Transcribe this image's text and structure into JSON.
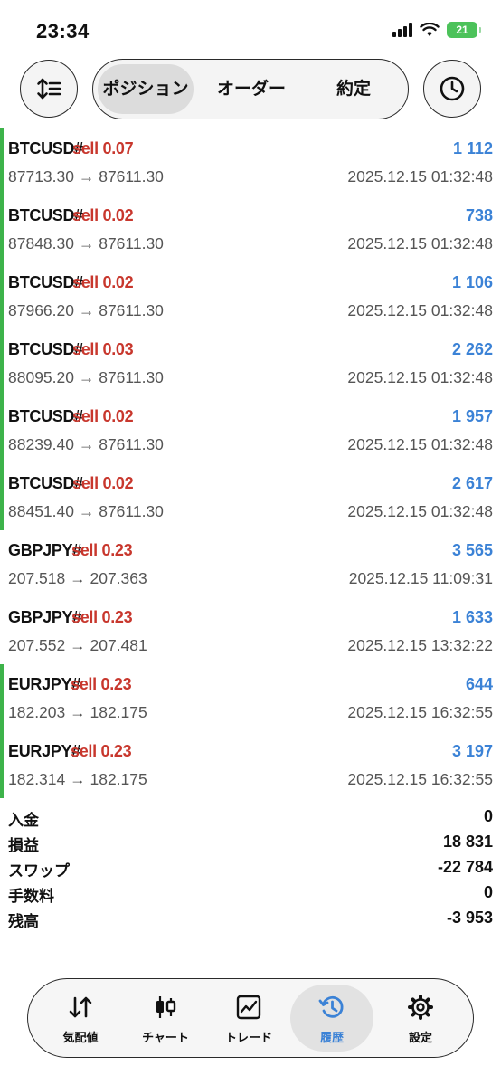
{
  "status_bar": {
    "time": "23:34",
    "battery": "21"
  },
  "top_tabs": {
    "positions": "ポジション",
    "orders": "オーダー",
    "deals": "約定"
  },
  "trades": [
    {
      "symbol": "BTCUSD#",
      "side": "sell 0.07",
      "profit": "1 112",
      "prices": "87713.30 → 87611.30",
      "time": "2025.12.15 01:32:48"
    },
    {
      "symbol": "BTCUSD#",
      "side": "sell 0.02",
      "profit": "738",
      "prices": "87848.30 → 87611.30",
      "time": "2025.12.15 01:32:48"
    },
    {
      "symbol": "BTCUSD#",
      "side": "sell 0.02",
      "profit": "1 106",
      "prices": "87966.20 → 87611.30",
      "time": "2025.12.15 01:32:48"
    },
    {
      "symbol": "BTCUSD#",
      "side": "sell 0.03",
      "profit": "2 262",
      "prices": "88095.20 → 87611.30",
      "time": "2025.12.15 01:32:48"
    },
    {
      "symbol": "BTCUSD#",
      "side": "sell 0.02",
      "profit": "1 957",
      "prices": "88239.40 → 87611.30",
      "time": "2025.12.15 01:32:48"
    },
    {
      "symbol": "BTCUSD#",
      "side": "sell 0.02",
      "profit": "2 617",
      "prices": "88451.40 → 87611.30",
      "time": "2025.12.15 01:32:48"
    },
    {
      "symbol": "GBPJPY#",
      "side": "sell 0.23",
      "profit": "3 565",
      "prices": "207.518 → 207.363",
      "time": "2025.12.15 11:09:31"
    },
    {
      "symbol": "GBPJPY#",
      "side": "sell 0.23",
      "profit": "1 633",
      "prices": "207.552 → 207.481",
      "time": "2025.12.15 13:32:22"
    },
    {
      "symbol": "EURJPY#",
      "side": "sell 0.23",
      "profit": "644",
      "prices": "182.203 → 182.175",
      "time": "2025.12.15 16:32:55"
    },
    {
      "symbol": "EURJPY#",
      "side": "sell 0.23",
      "profit": "3 197",
      "prices": "182.314 → 182.175",
      "time": "2025.12.15 16:32:55"
    }
  ],
  "summary": {
    "deposit": {
      "label": "入金",
      "value": "0"
    },
    "profit": {
      "label": "損益",
      "value": "18 831"
    },
    "swap": {
      "label": "スワップ",
      "value": "-22 784"
    },
    "commission": {
      "label": "手数料",
      "value": "0"
    },
    "balance": {
      "label": "残高",
      "value": "-3 953"
    }
  },
  "bottom_nav": {
    "quotes": "気配値",
    "chart": "チャート",
    "trade": "トレード",
    "history": "履歴",
    "settings": "設定"
  },
  "colors": {
    "sell": "#c8372d",
    "profit": "#3b82d6",
    "accent_bar": "#3db34a",
    "battery": "#4cc25a"
  }
}
